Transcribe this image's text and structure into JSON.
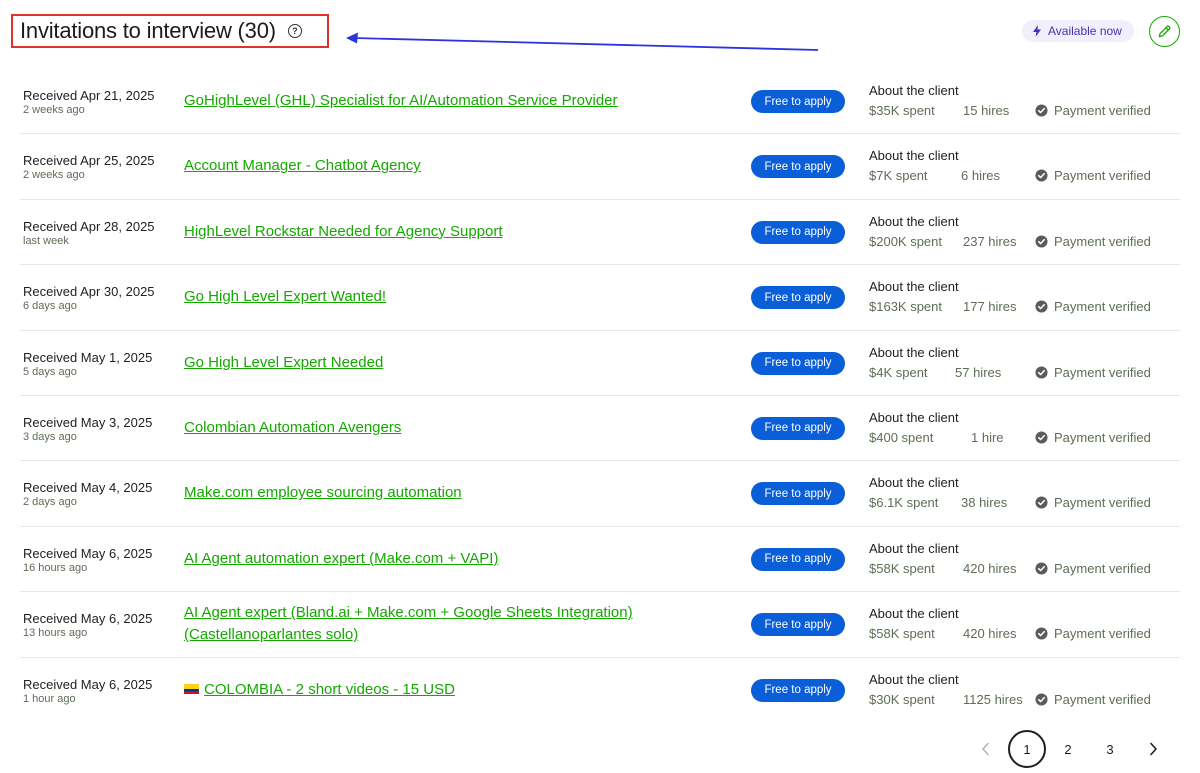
{
  "header": {
    "title": "Invitations to interview (30)",
    "help_icon": "help-circle-icon",
    "availability_label": "Available now",
    "availability_icon": "bolt-icon",
    "edit_icon": "pencil-icon"
  },
  "colors": {
    "link_green": "#14a800",
    "apply_blue": "#0a5ed8",
    "highlight_red": "#e0322b",
    "arrow_blue": "#2a35e0",
    "availability_purple": "#4a2fbd"
  },
  "invitations": [
    {
      "received": "Received Apr 21, 2025",
      "ago": "2 weeks ago",
      "title": "GoHighLevel (GHL) Specialist for AI/Automation Service Provider",
      "badge": "Free to apply",
      "about": "About the client",
      "spent": "$35K spent",
      "hires": "15 hires",
      "verified": "Payment verified"
    },
    {
      "received": "Received Apr 25, 2025",
      "ago": "2 weeks ago",
      "title": "Account Manager - Chatbot Agency",
      "badge": "Free to apply",
      "about": "About the client",
      "spent": "$7K spent",
      "hires": "6 hires",
      "verified": "Payment verified"
    },
    {
      "received": "Received Apr 28, 2025",
      "ago": "last week",
      "title": "HighLevel Rockstar Needed for Agency Support",
      "badge": "Free to apply",
      "about": "About the client",
      "spent": "$200K spent",
      "hires": "237 hires",
      "verified": "Payment verified"
    },
    {
      "received": "Received Apr 30, 2025",
      "ago": "6 days ago",
      "title": "Go High Level Expert Wanted!",
      "badge": "Free to apply",
      "about": "About the client",
      "spent": "$163K spent",
      "hires": "177 hires",
      "verified": "Payment verified"
    },
    {
      "received": "Received May 1, 2025",
      "ago": "5 days ago",
      "title": "Go High Level Expert Needed",
      "badge": "Free to apply",
      "about": "About the client",
      "spent": "$4K spent",
      "hires": "57 hires",
      "verified": "Payment verified"
    },
    {
      "received": "Received May 3, 2025",
      "ago": "3 days ago",
      "title": "Colombian Automation Avengers",
      "badge": "Free to apply",
      "about": "About the client",
      "spent": "$400 spent",
      "hires": "1 hire",
      "verified": "Payment verified"
    },
    {
      "received": "Received May 4, 2025",
      "ago": "2 days ago",
      "title": "Make.com employee sourcing automation",
      "badge": "Free to apply",
      "about": "About the client",
      "spent": "$6.1K spent",
      "hires": "38 hires",
      "verified": "Payment verified"
    },
    {
      "received": "Received May 6, 2025",
      "ago": "16 hours ago",
      "title": "AI Agent automation expert (Make.com + VAPI)",
      "badge": "Free to apply",
      "about": "About the client",
      "spent": "$58K spent",
      "hires": "420 hires",
      "verified": "Payment verified"
    },
    {
      "received": "Received May 6, 2025",
      "ago": "13 hours ago",
      "title": "AI Agent expert (Bland.ai + Make.com + Google Sheets Integration) (Castellanoparlantes solo)",
      "badge": "Free to apply",
      "about": "About the client",
      "spent": "$58K spent",
      "hires": "420 hires",
      "verified": "Payment verified"
    },
    {
      "received": "Received May 6, 2025",
      "ago": "1 hour ago",
      "title": "COLOMBIA - 2 short videos - 15 USD",
      "badge": "Free to apply",
      "about": "About the client",
      "spent": "$30K spent",
      "hires": "1125 hires",
      "verified": "Payment verified"
    }
  ],
  "pagination": {
    "prev_icon": "chevron-left-icon",
    "pages": [
      "1",
      "2",
      "3"
    ],
    "current": "1",
    "next_icon": "chevron-right-icon"
  }
}
